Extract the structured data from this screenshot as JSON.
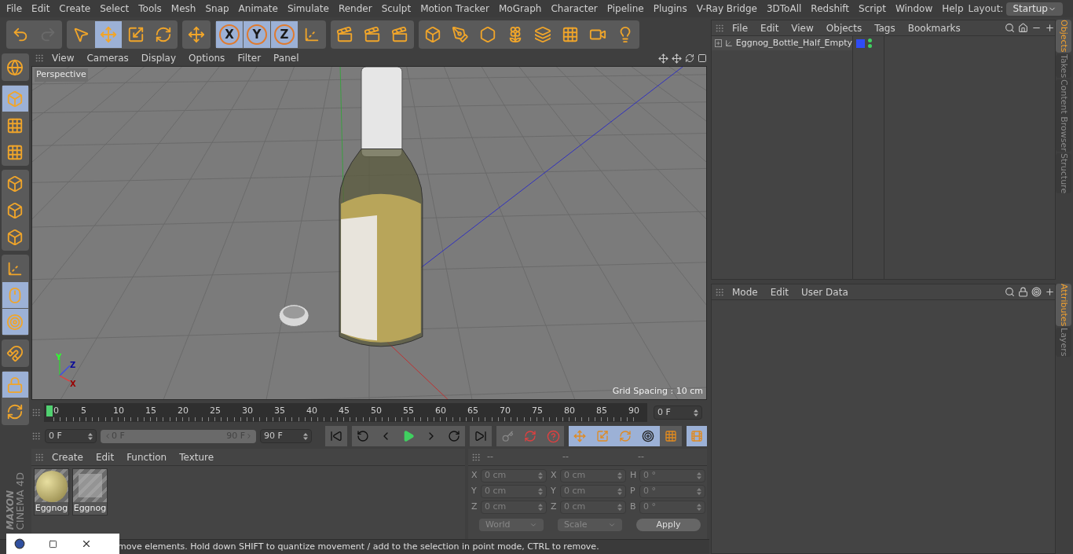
{
  "menu": [
    "File",
    "Edit",
    "Create",
    "Select",
    "Tools",
    "Mesh",
    "Snap",
    "Animate",
    "Simulate",
    "Render",
    "Sculpt",
    "Motion Tracker",
    "MoGraph",
    "Character",
    "Pipeline",
    "Plugins",
    "V-Ray Bridge",
    "3DToAll",
    "Redshift",
    "Script",
    "Window",
    "Help"
  ],
  "layout": {
    "label": "Layout:",
    "value": "Startup"
  },
  "toolbar": [
    [
      {
        "selected": false
      },
      {
        "selected": false,
        "disabled": true
      }
    ],
    [
      {
        "selected": false
      },
      {
        "selected": true
      },
      {
        "selected": false
      },
      {
        "selected": false
      }
    ],
    [
      {
        "selected": false
      }
    ],
    [
      {
        "label": "X",
        "selected": true
      },
      {
        "label": "Y",
        "selected": true
      },
      {
        "label": "Z",
        "selected": true
      },
      {
        "selected": false
      }
    ],
    [
      {
        "selected": false
      },
      {
        "selected": false
      },
      {
        "selected": false
      }
    ],
    [
      {
        "selected": false
      },
      {
        "selected": false
      },
      {
        "selected": false
      },
      {
        "selected": false
      },
      {
        "selected": false
      },
      {
        "selected": false
      },
      {
        "selected": false
      },
      {
        "selected": false
      }
    ]
  ],
  "left_toolbar": [
    [
      {
        "selected": false
      }
    ],
    [
      {
        "selected": true
      },
      {
        "selected": false
      },
      {
        "selected": false
      }
    ],
    [
      {
        "selected": false
      },
      {
        "selected": false
      },
      {
        "selected": false
      }
    ],
    [
      {
        "selected": false
      },
      {
        "selected": true
      },
      {
        "selected": true
      }
    ],
    [
      {
        "selected": false
      }
    ],
    [
      {
        "selected": true
      },
      {
        "selected": false
      }
    ]
  ],
  "logo": {
    "brand": "MAXON",
    "product": "CINEMA 4D"
  },
  "viewport": {
    "menu": [
      "View",
      "Cameras",
      "Display",
      "Options",
      "Filter",
      "Panel"
    ],
    "camera": "Perspective",
    "axis_labels": [
      "Y",
      "Z",
      "X"
    ],
    "grid_spacing": "Grid Spacing : 10 cm"
  },
  "timeline": {
    "ticks": [
      "0",
      "5",
      "10",
      "15",
      "20",
      "25",
      "30",
      "35",
      "40",
      "45",
      "50",
      "55",
      "60",
      "65",
      "70",
      "75",
      "80",
      "85",
      "90"
    ],
    "current_frame": "0 F",
    "start": "0 F",
    "range_start": "0 F",
    "range_end": "90 F",
    "end": "90 F"
  },
  "materials": {
    "menu": [
      "Create",
      "Edit",
      "Function",
      "Texture"
    ],
    "items": [
      {
        "name": "Eggnog",
        "kind": "sphere"
      },
      {
        "name": "Eggnog",
        "kind": "texture"
      }
    ]
  },
  "coordinates": {
    "headers": [
      "--",
      "--",
      "--"
    ],
    "rows": [
      {
        "a": "X",
        "a_value": "0 cm",
        "b": "X",
        "b_value": "0 cm",
        "c": "H",
        "c_value": "0 °"
      },
      {
        "a": "Y",
        "a_value": "0 cm",
        "b": "Y",
        "b_value": "0 cm",
        "c": "P",
        "c_value": "0 °"
      },
      {
        "a": "Z",
        "a_value": "0 cm",
        "b": "Z",
        "b_value": "0 cm",
        "c": "B",
        "c_value": "0 °"
      }
    ],
    "space": "World",
    "mode": "Scale",
    "apply": "Apply"
  },
  "status_bar": "move elements. Hold down SHIFT to quantize movement / add to the selection in point mode, CTRL to remove.",
  "objects": {
    "menu": [
      "File",
      "Edit",
      "View",
      "Objects",
      "Tags",
      "Bookmarks"
    ],
    "items": [
      {
        "name": "Eggnog_Bottle_Half_Empty",
        "expanded": false,
        "color": "#2f4cf5"
      }
    ]
  },
  "attributes": {
    "menu": [
      "Mode",
      "Edit",
      "User Data"
    ]
  },
  "side_tabs_top": [
    {
      "label": "Objects",
      "selected": true
    },
    {
      "label": "Takes",
      "selected": false
    },
    {
      "label": "Content Browser",
      "selected": false
    },
    {
      "label": "Structure",
      "selected": false
    }
  ],
  "side_tabs_bottom": [
    {
      "label": "Attributes",
      "selected": true
    },
    {
      "label": "Layers",
      "selected": false
    }
  ]
}
